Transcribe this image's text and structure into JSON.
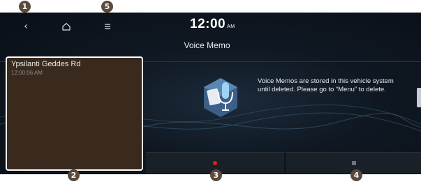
{
  "header": {
    "back_icon": "back-icon",
    "home_icon": "home-icon",
    "menu_icon": "menu-icon",
    "clock": "12:00",
    "ampm": "AM"
  },
  "page_title": "Voice Memo",
  "memo_list": [
    {
      "name": "Ypsilanti Geddes Rd",
      "time": "12:00:06 AM"
    }
  ],
  "info_text": "Voice Memos are stored in this vehicle system until deleted. Please go to “Menu” to delete.",
  "buttons": {
    "record_icon": "record-icon",
    "stop_icon": "stop-icon"
  },
  "callouts": [
    "1",
    "2",
    "3",
    "4",
    "5"
  ],
  "colors": {
    "accent_record": "#e0201c",
    "callout_bg": "#5a4a3c",
    "screen_bg": "#0f1822"
  }
}
